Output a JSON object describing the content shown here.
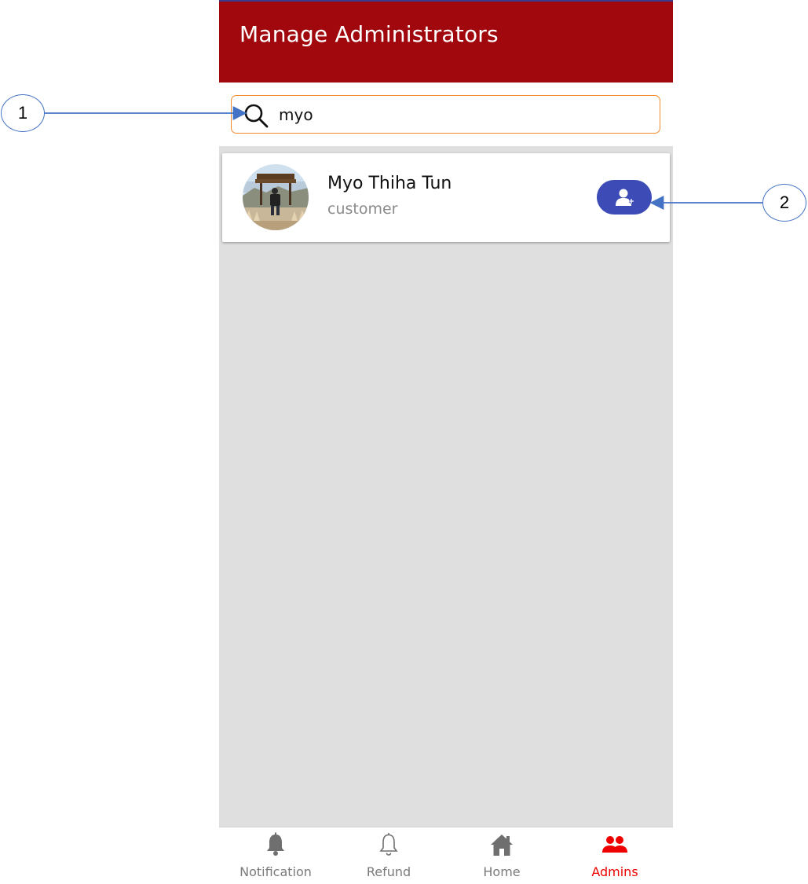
{
  "header": {
    "title": "Manage Administrators"
  },
  "search": {
    "value": "myo",
    "icon": "search-icon"
  },
  "results": [
    {
      "name": "Myo Thiha Tun",
      "role": "customer",
      "action_icon": "add-user-icon"
    }
  ],
  "bottom_nav": [
    {
      "label": "Notification",
      "icon": "bell-filled-icon",
      "active": false
    },
    {
      "label": "Refund",
      "icon": "bell-outline-icon",
      "active": false
    },
    {
      "label": "Home",
      "icon": "home-icon",
      "active": false
    },
    {
      "label": "Admins",
      "icon": "people-icon",
      "active": true
    }
  ],
  "annotations": [
    {
      "label": "1"
    },
    {
      "label": "2"
    }
  ],
  "colors": {
    "header": "#a1080d",
    "search_border": "#f08a2a",
    "action_button": "#3c4bb5",
    "active_nav": "#ee0000",
    "annotation": "#4472c4"
  }
}
